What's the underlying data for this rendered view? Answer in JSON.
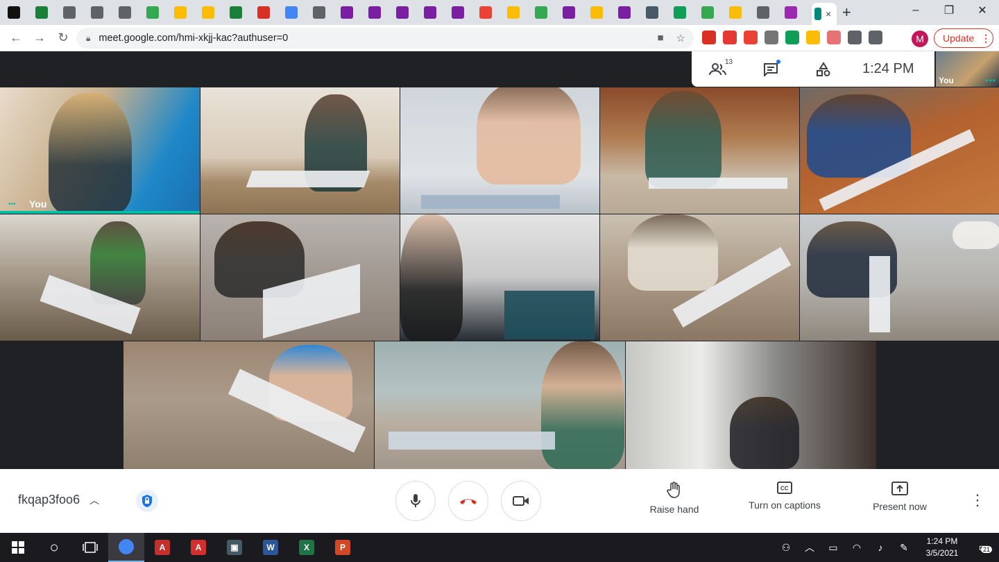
{
  "browser": {
    "active_tab_close": "×",
    "new_tab": "+",
    "tab_favicons": [
      "#e8453c",
      "#188038",
      "#5f6368",
      "#5f6368",
      "#5f6368",
      "#34a853",
      "#fbbc04",
      "#fbbc04",
      "#188038",
      "#d93025",
      "#4285f4",
      "#5f6368",
      "#7b1fa2",
      "#7b1fa2",
      "#7b1fa2",
      "#7b1fa2",
      "#7b1fa2",
      "#ea4335",
      "#fbbc04",
      "#34a853",
      "#7b1fa2",
      "#fbbc04",
      "#7b1fa2",
      "#455a64",
      "#0f9d58",
      "#34a853",
      "#fbbc04",
      "#5f6368",
      "#9c27b0"
    ],
    "window_controls": [
      "–",
      "❐",
      "✕"
    ],
    "url": "meet.google.com/hmi-xkjj-kac?authuser=0",
    "extensions": [
      "#d93025",
      "#e53935",
      "#ea4335",
      "#757575",
      "#0f9d58",
      "#fbbc04",
      "#e57373",
      "#5f6368",
      "#5f6368"
    ],
    "profile_initial": "M",
    "update_label": "Update",
    "update_menu": "⋮"
  },
  "meet": {
    "participants_count": "13",
    "clock": "1:24 PM",
    "self_view_label": "You",
    "self_view_dots": "•••",
    "tiles": [
      {
        "label": "You",
        "dots": "•••"
      }
    ],
    "meeting_code": "fkqap3foo6",
    "meeting_code_chevron": "^",
    "actions": {
      "raise_hand": "Raise hand",
      "captions": "Turn on captions",
      "present": "Present now"
    },
    "more_menu": "⋮"
  },
  "taskbar": {
    "search_icon": "○",
    "apps": [
      {
        "name": "chrome",
        "color": "#4285f4",
        "glyph": ""
      },
      {
        "name": "acrobat-reader",
        "color": "#c4302b",
        "glyph": "A"
      },
      {
        "name": "acrobat",
        "color": "#d32f2f",
        "glyph": "A"
      },
      {
        "name": "remote-desktop",
        "color": "#455a64",
        "glyph": "▣"
      },
      {
        "name": "word",
        "color": "#2b579a",
        "glyph": "W"
      },
      {
        "name": "excel",
        "color": "#217346",
        "glyph": "X"
      },
      {
        "name": "powerpoint",
        "color": "#d24726",
        "glyph": "P"
      }
    ],
    "time": "1:24 PM",
    "date": "3/5/2021",
    "notification_count": "21"
  }
}
